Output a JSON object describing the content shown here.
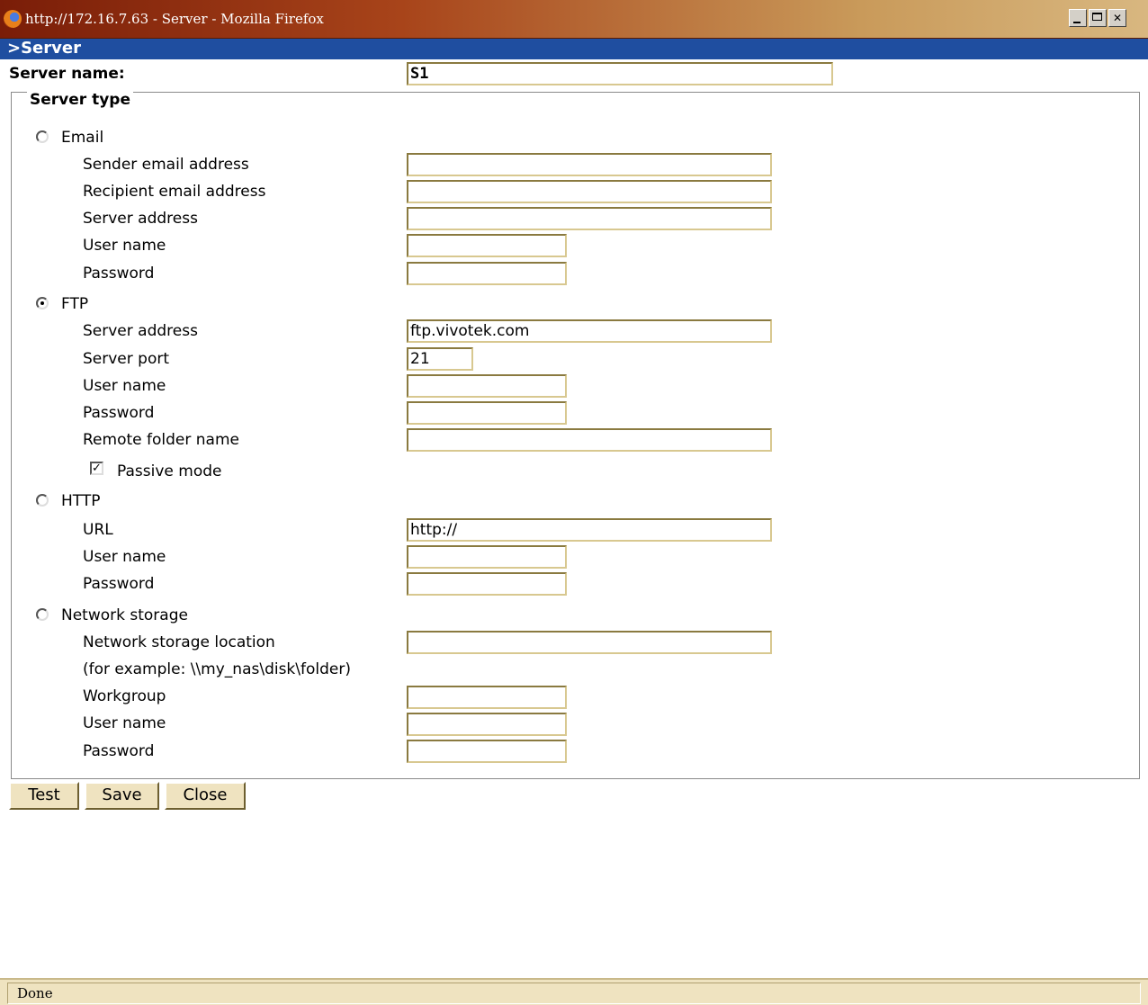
{
  "window": {
    "title": "http://172.16.7.63 - Server - Mozilla Firefox",
    "controls": [
      "minimize",
      "maximize",
      "close"
    ]
  },
  "header": {
    "title": ">Server"
  },
  "server_name": {
    "label": "Server name:",
    "value": "S1"
  },
  "server_type": {
    "legend": "Server type",
    "email": {
      "label": "Email",
      "selected": false,
      "fields": {
        "sender": {
          "label": "Sender email address",
          "value": ""
        },
        "recipient": {
          "label": "Recipient email address",
          "value": ""
        },
        "server_address": {
          "label": "Server address",
          "value": ""
        },
        "user_name": {
          "label": "User name",
          "value": ""
        },
        "password": {
          "label": "Password",
          "value": ""
        }
      }
    },
    "ftp": {
      "label": "FTP",
      "selected": true,
      "fields": {
        "server_address": {
          "label": "Server address",
          "value": "ftp.vivotek.com"
        },
        "server_port": {
          "label": "Server port",
          "value": "21"
        },
        "user_name": {
          "label": "User name",
          "value": ""
        },
        "password": {
          "label": "Password",
          "value": ""
        },
        "remote_folder": {
          "label": "Remote folder name",
          "value": ""
        }
      },
      "passive_mode": {
        "label": "Passive mode",
        "checked": true
      }
    },
    "http": {
      "label": "HTTP",
      "selected": false,
      "fields": {
        "url": {
          "label": "URL",
          "value": "http://"
        },
        "user_name": {
          "label": "User name",
          "value": ""
        },
        "password": {
          "label": "Password",
          "value": ""
        }
      }
    },
    "network_storage": {
      "label": "Network storage",
      "selected": false,
      "fields": {
        "location": {
          "label": "Network storage location",
          "value": ""
        },
        "example": "(for example: \\\\my_nas\\disk\\folder)",
        "workgroup": {
          "label": "Workgroup",
          "value": ""
        },
        "user_name": {
          "label": "User name",
          "value": ""
        },
        "password": {
          "label": "Password",
          "value": ""
        }
      }
    }
  },
  "buttons": {
    "test": "Test",
    "save": "Save",
    "close": "Close"
  },
  "status": {
    "text": "Done"
  },
  "colors": {
    "header_bg": "#1f4ea0",
    "button_bg": "#efe3c0",
    "field_border": "#d8c890"
  }
}
